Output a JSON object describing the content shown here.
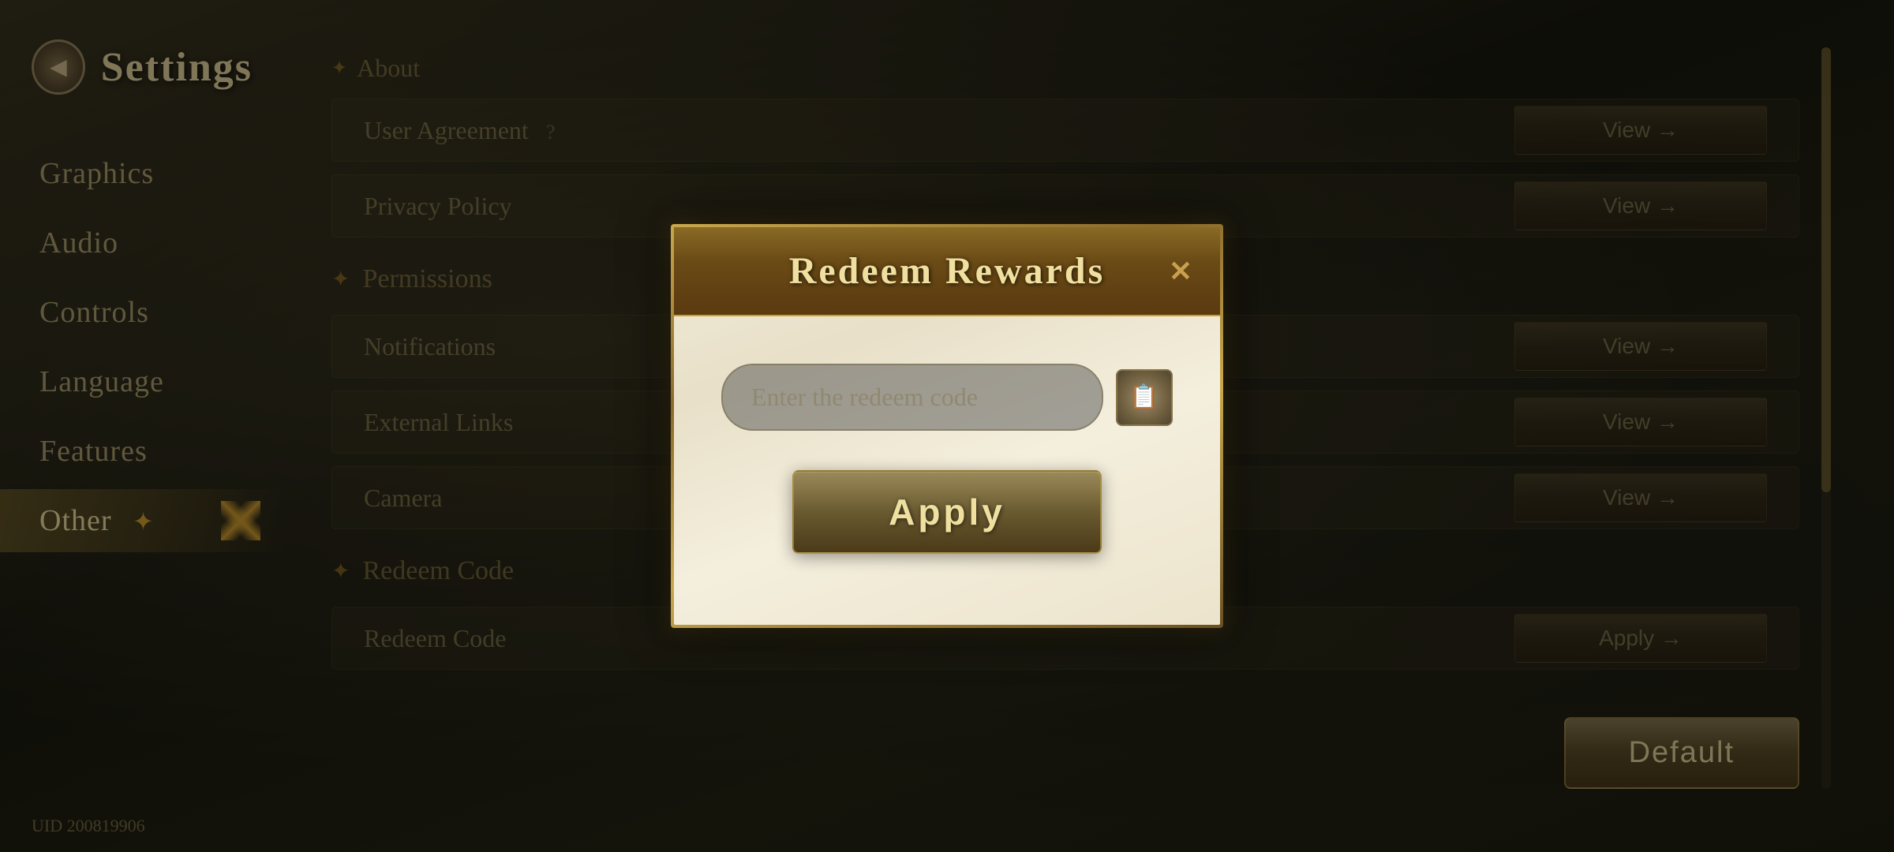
{
  "app": {
    "title": "Settings",
    "uid": "UID 200819906"
  },
  "sidebar": {
    "back_icon": "◀",
    "items": [
      {
        "id": "graphics",
        "label": "Graphics",
        "active": false
      },
      {
        "id": "audio",
        "label": "Audio",
        "active": false
      },
      {
        "id": "controls",
        "label": "Controls",
        "active": false
      },
      {
        "id": "language",
        "label": "Language",
        "active": false
      },
      {
        "id": "features",
        "label": "Features",
        "active": false
      },
      {
        "id": "other",
        "label": "Other",
        "active": true
      }
    ]
  },
  "main": {
    "sections": [
      {
        "type": "header",
        "label": "About"
      },
      {
        "type": "row",
        "label": "User Agreement",
        "extra": "?",
        "action": "View →"
      },
      {
        "type": "row",
        "label": "Privacy Policy",
        "action": "View →"
      },
      {
        "type": "section_header",
        "label": "Permissions"
      },
      {
        "type": "row",
        "label": "Notifications",
        "action": "View →"
      },
      {
        "type": "row",
        "label": "External Links",
        "action": "View →"
      },
      {
        "type": "row",
        "label": "Camera",
        "action": "View →"
      },
      {
        "type": "section_header",
        "label": "Redeem Code"
      },
      {
        "type": "row",
        "label": "Redeem Code",
        "action": "Apply →"
      }
    ],
    "default_button": "Default"
  },
  "modal": {
    "title": "Redeem Rewards",
    "close_icon": "✕",
    "input_placeholder": "Enter the redeem code",
    "paste_icon": "📋",
    "apply_button": "Apply"
  }
}
